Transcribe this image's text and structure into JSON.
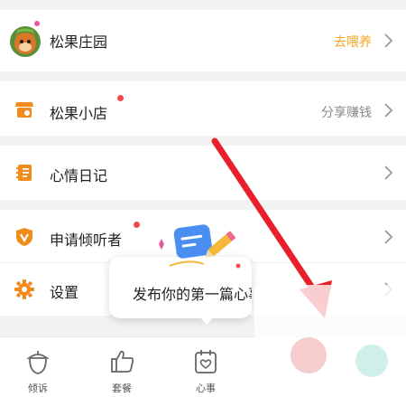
{
  "menu": {
    "items": [
      {
        "label": "松果庄园",
        "right_text": "去喂养",
        "icon": "squirrel-avatar-icon"
      },
      {
        "label": "松果小店",
        "right_text": "分享赚钱",
        "icon": "shop-icon"
      },
      {
        "label": "心情日记",
        "right_text": "",
        "icon": "diary-icon"
      },
      {
        "label": "申请倾听者",
        "right_text": "",
        "icon": "listener-badge-icon"
      },
      {
        "label": "设置",
        "right_text": "",
        "icon": "gear-icon"
      }
    ]
  },
  "tooltip": {
    "text": "发布你的第一篇心事"
  },
  "tabbar": {
    "tabs": [
      {
        "label": "倾诉",
        "icon": "acorn-icon"
      },
      {
        "label": "套餐",
        "icon": "thumbs-up-icon"
      },
      {
        "label": "心事",
        "icon": "calendar-heart-icon"
      }
    ]
  },
  "colors": {
    "accent_orange": "#f5a623",
    "icon_orange": "#f08c1c",
    "badge_red": "#ef4b4b",
    "annotation_arrow": "#e8202a",
    "tooltip_blue": "#4a8ef2"
  }
}
